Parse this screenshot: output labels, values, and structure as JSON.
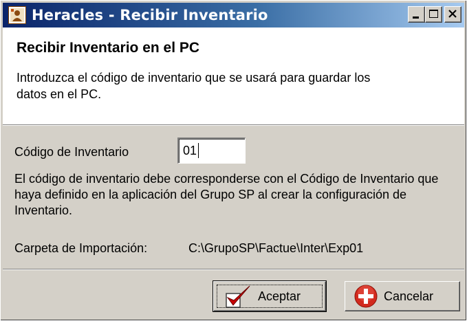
{
  "window": {
    "title": "Heracles - Recibir Inventario",
    "icon": "app-icon",
    "controls": [
      "minimize",
      "maximize",
      "close"
    ]
  },
  "header": {
    "title": "Recibir Inventario en el PC",
    "description": "Introduzca el código de inventario que se usará para guardar los datos en el PC."
  },
  "form": {
    "code_label": "Código  de Inventario",
    "code_value": "01",
    "info_text": "El código de inventario debe corresponderse con el Código de Inventario que haya definido en la aplicación del Grupo SP al crear la configuración de Inventario.",
    "folder_label": "Carpeta de Importación:",
    "folder_path": "C:\\GrupoSP\\Factue\\Inter\\Exp01"
  },
  "buttons": {
    "accept_label": "Aceptar",
    "accept_icon": "checkmark-icon",
    "cancel_label": "Cancelar",
    "cancel_icon": "cancel-icon"
  },
  "colors": {
    "titlebar_start": "#0a246a",
    "titlebar_end": "#a6caf0",
    "face": "#d4d0c8",
    "accept_check": "#c80000",
    "cancel_circle": "#d22a1e"
  }
}
